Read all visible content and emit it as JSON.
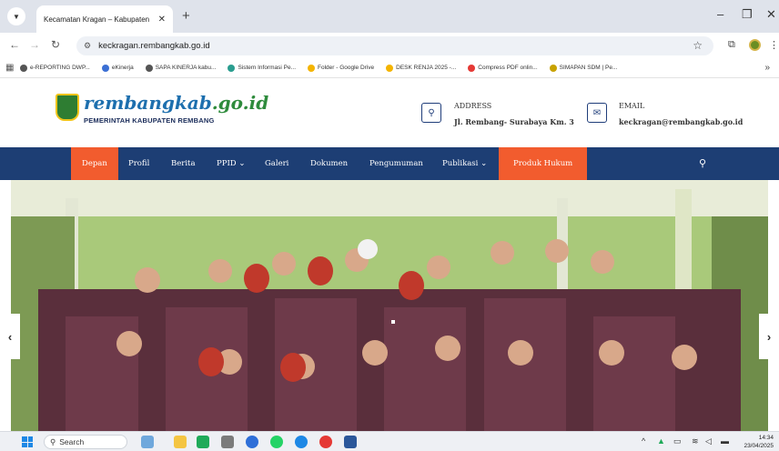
{
  "browser": {
    "tab_title": "Kecamatan Kragan – Kabupaten",
    "url": "keckragan.rembangkab.go.id",
    "bookmarks": [
      {
        "label": "e-REPORTING DWP...",
        "color": "#555555"
      },
      {
        "label": "eKinerja",
        "color": "#3b6fd4"
      },
      {
        "label": "SAPA KINERJA kabu...",
        "color": "#555555"
      },
      {
        "label": "Sistem Informasi Pe...",
        "color": "#2a9d8f"
      },
      {
        "label": "Folder - Google Drive",
        "color": "#f4b400"
      },
      {
        "label": "DESK RENJA 2025 -...",
        "color": "#f4b400"
      },
      {
        "label": "Compress PDF onlin...",
        "color": "#e53935"
      },
      {
        "label": "SIMAPAN SDM | Pe...",
        "color": "#c8a200"
      }
    ]
  },
  "site": {
    "logo_part1": "rembangkab",
    "logo_part2": ".go.id",
    "logo_sub": "PEMERINTAH KABUPATEN REMBANG",
    "address_label": "ADDRESS",
    "address_value": "Jl. Rembang- Surabaya Km. 3",
    "email_label": "EMAIL",
    "email_value": "keckragan@rembangkab.go.id"
  },
  "nav": {
    "items": [
      "Depan",
      "Profil",
      "Berita",
      "PPID ⌄",
      "Galeri",
      "Dokumen",
      "Pengumuman",
      "Publikasi ⌄",
      "Produk Hukum"
    ]
  },
  "taskbar": {
    "search_label": "Search",
    "time": "14:34",
    "date": "23/04/2025"
  },
  "colors": {
    "nav_bg": "#1d3e74",
    "accent": "#f25c2e"
  }
}
